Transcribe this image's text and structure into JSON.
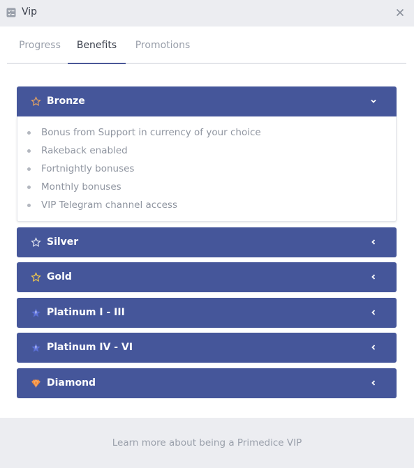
{
  "window": {
    "title": "Vip",
    "icon": "checklist-icon",
    "close_icon": "close-icon"
  },
  "tabs": [
    {
      "label": "Progress",
      "active": false
    },
    {
      "label": "Benefits",
      "active": true
    },
    {
      "label": "Promotions",
      "active": false
    }
  ],
  "tiers": [
    {
      "label": "Bronze",
      "icon": "star-outline-icon",
      "icon_color": "#e0a062",
      "expanded": true,
      "benefits": [
        "Bonus from Support in currency of your choice",
        "Rakeback enabled",
        "Fortnightly bonuses",
        "Monthly bonuses",
        "VIP Telegram channel access"
      ]
    },
    {
      "label": "Silver",
      "icon": "star-outline-icon",
      "icon_color": "#dfe3ee",
      "expanded": false
    },
    {
      "label": "Gold",
      "icon": "star-outline-icon",
      "icon_color": "#f2c94c",
      "expanded": false
    },
    {
      "label": "Platinum I - III",
      "icon": "platinum-star-icon",
      "icon_color": "#5b6fd6",
      "expanded": false
    },
    {
      "label": "Platinum IV - VI",
      "icon": "platinum-star-icon",
      "icon_color": "#5b6fd6",
      "expanded": false
    },
    {
      "label": "Diamond",
      "icon": "diamond-icon",
      "icon_color": "#f08a3c",
      "expanded": false
    }
  ],
  "footer": {
    "link_text": "Learn more about being a Primedice VIP"
  },
  "colors": {
    "header_bg": "#ecedf1",
    "accordion_bg": "#45569a",
    "tab_active_underline": "#4a5898"
  }
}
